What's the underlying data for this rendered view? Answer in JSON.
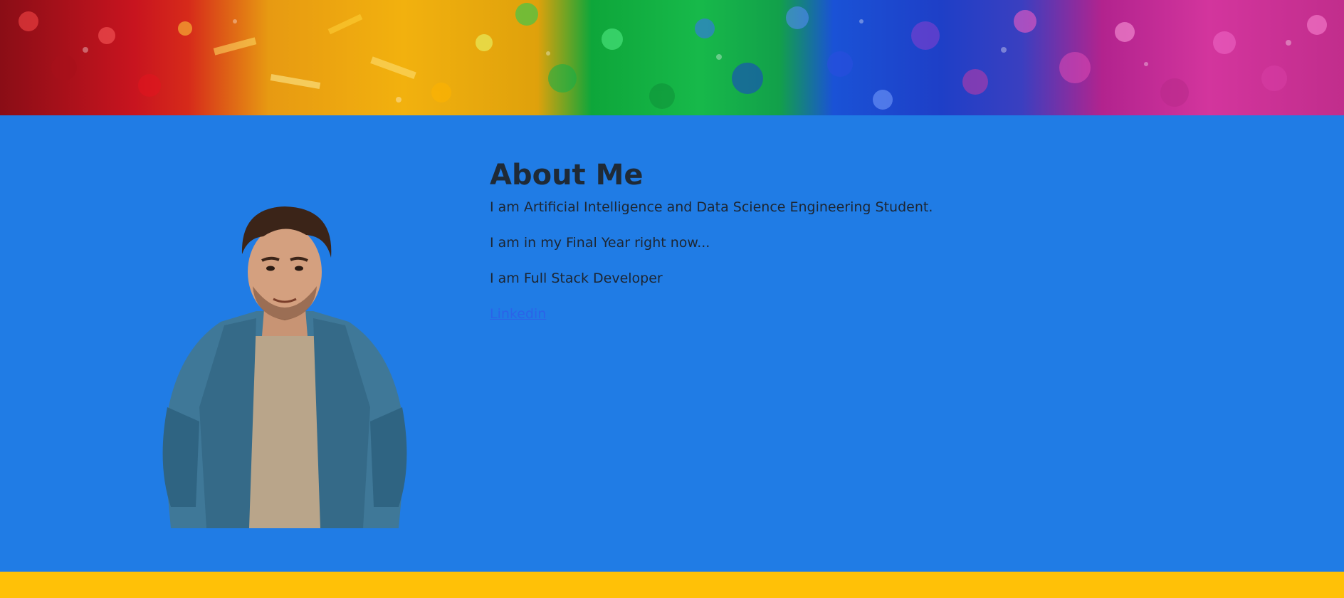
{
  "banner": {
    "alt": "glitter banner"
  },
  "about": {
    "title": "About Me",
    "lines": [
      "I am Artificial Intelligence and Data Science Engineering Student.",
      "I am in my Final Year right now...",
      "I am Full Stack Developer"
    ],
    "link_label": "Linkedin"
  },
  "colors": {
    "section_bg": "#207ce5",
    "footer_bg": "#ffc107",
    "link": "#2b63e8"
  }
}
